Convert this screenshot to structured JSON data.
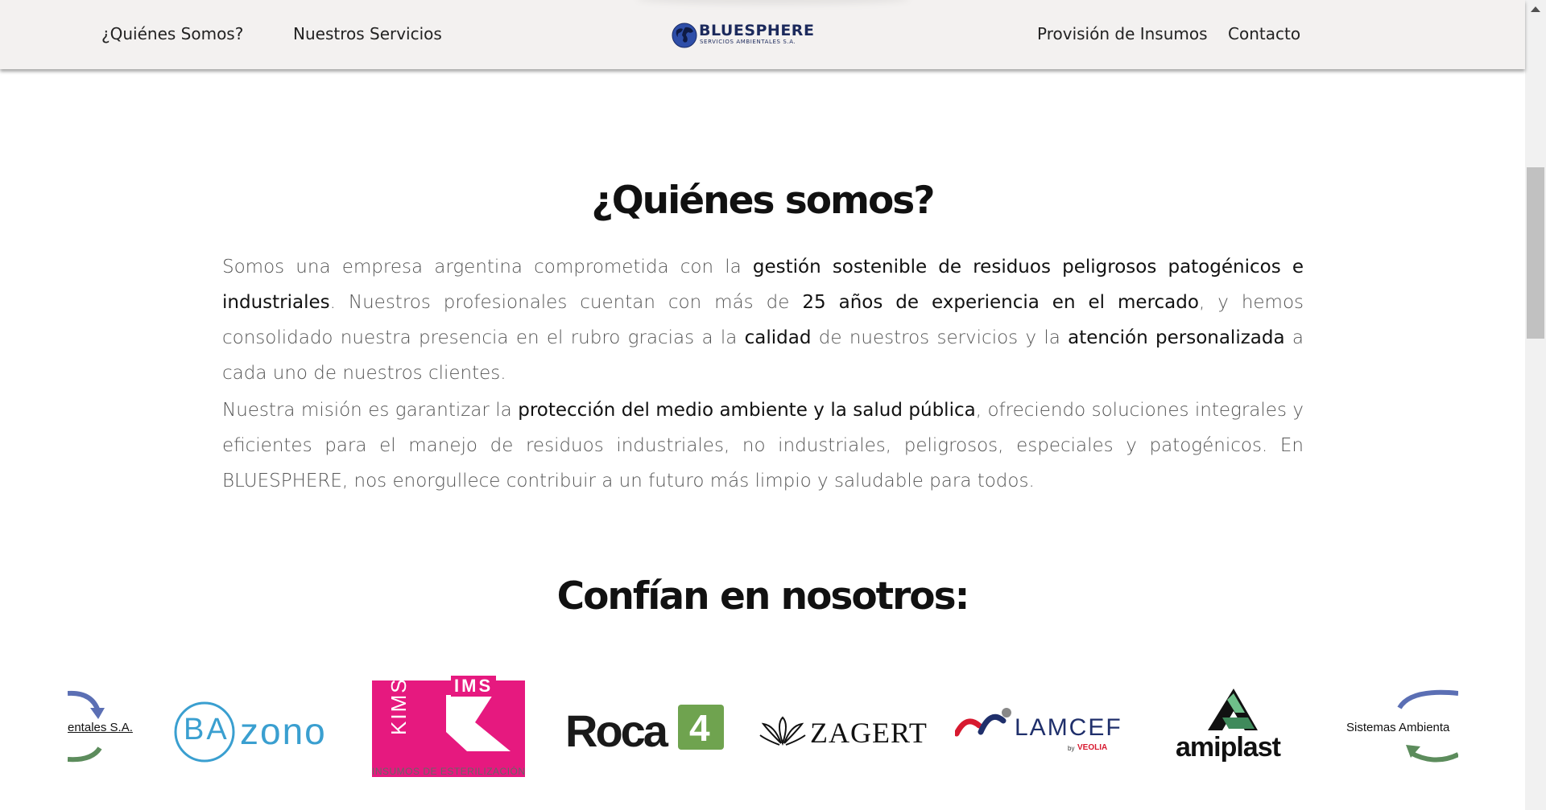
{
  "nav": {
    "left": [
      "¿Quiénes Somos?",
      "Nuestros Servicios"
    ],
    "right": [
      "Provisión de Insumos",
      "Contacto"
    ]
  },
  "logo": {
    "name": "BLUESPHERE",
    "subtitle": "SERVICIOS AMBIENTALES S.A."
  },
  "about": {
    "title": "¿Quiénes somos?",
    "p1": [
      {
        "t": "Somos una empresa argentina comprometida con la ",
        "b": false
      },
      {
        "t": "gestión sostenible de residuos peligrosos patogénicos e industriales",
        "b": true
      },
      {
        "t": ". Nuestros profesionales cuentan con más de ",
        "b": false
      },
      {
        "t": "25 años de experiencia en el mercado",
        "b": true
      },
      {
        "t": ", y hemos consolidado nuestra presencia en el rubro gracias a la ",
        "b": false
      },
      {
        "t": "calidad",
        "b": true
      },
      {
        "t": " de nuestros servicios y la ",
        "b": false
      },
      {
        "t": "atención personalizada",
        "b": true
      },
      {
        "t": " a cada uno de nuestros clientes.",
        "b": false
      }
    ],
    "p2": [
      {
        "t": "Nuestra misión es garantizar la ",
        "b": false
      },
      {
        "t": "protección del medio ambiente y la salud pública",
        "b": true
      },
      {
        "t": ", ofreciendo soluciones integrales y eficientes para el manejo de residuos industriales, no industriales, peligrosos, especiales y patogénicos. En BLUESPHERE, nos enorgullece contribuir a un futuro más limpio y saludable para todos.",
        "b": false
      }
    ]
  },
  "clients": {
    "title": "Confían en nosotros:",
    "logos": [
      {
        "name": "sistemas-ambientales",
        "text": "entales S.A."
      },
      {
        "name": "bazono",
        "text1": "BA",
        "text2": "zono"
      },
      {
        "name": "kims-ims",
        "text1": "KIMS",
        "text2": "IMS",
        "text3": "INSUMOS DE ESTERILIZACIÓN"
      },
      {
        "name": "roca4",
        "text1": "Roca",
        "text2": "4"
      },
      {
        "name": "zagert",
        "text": "ZAGERT"
      },
      {
        "name": "lamcef",
        "text1": "LAMCEF",
        "text2": "by",
        "text3": "VEOLIA"
      },
      {
        "name": "amiplast",
        "text": "amiplast"
      },
      {
        "name": "sistemas-ambientales-2",
        "text": "Sistemas Ambienta"
      }
    ]
  },
  "colors": {
    "brand": "#1c2a5c",
    "kims_pink": "#e6197f",
    "roca_green": "#6fa34f",
    "bazono_blue": "#3a9fd0",
    "lamcef_red": "#d7192f",
    "lamcef_navy": "#1f2f6b"
  }
}
